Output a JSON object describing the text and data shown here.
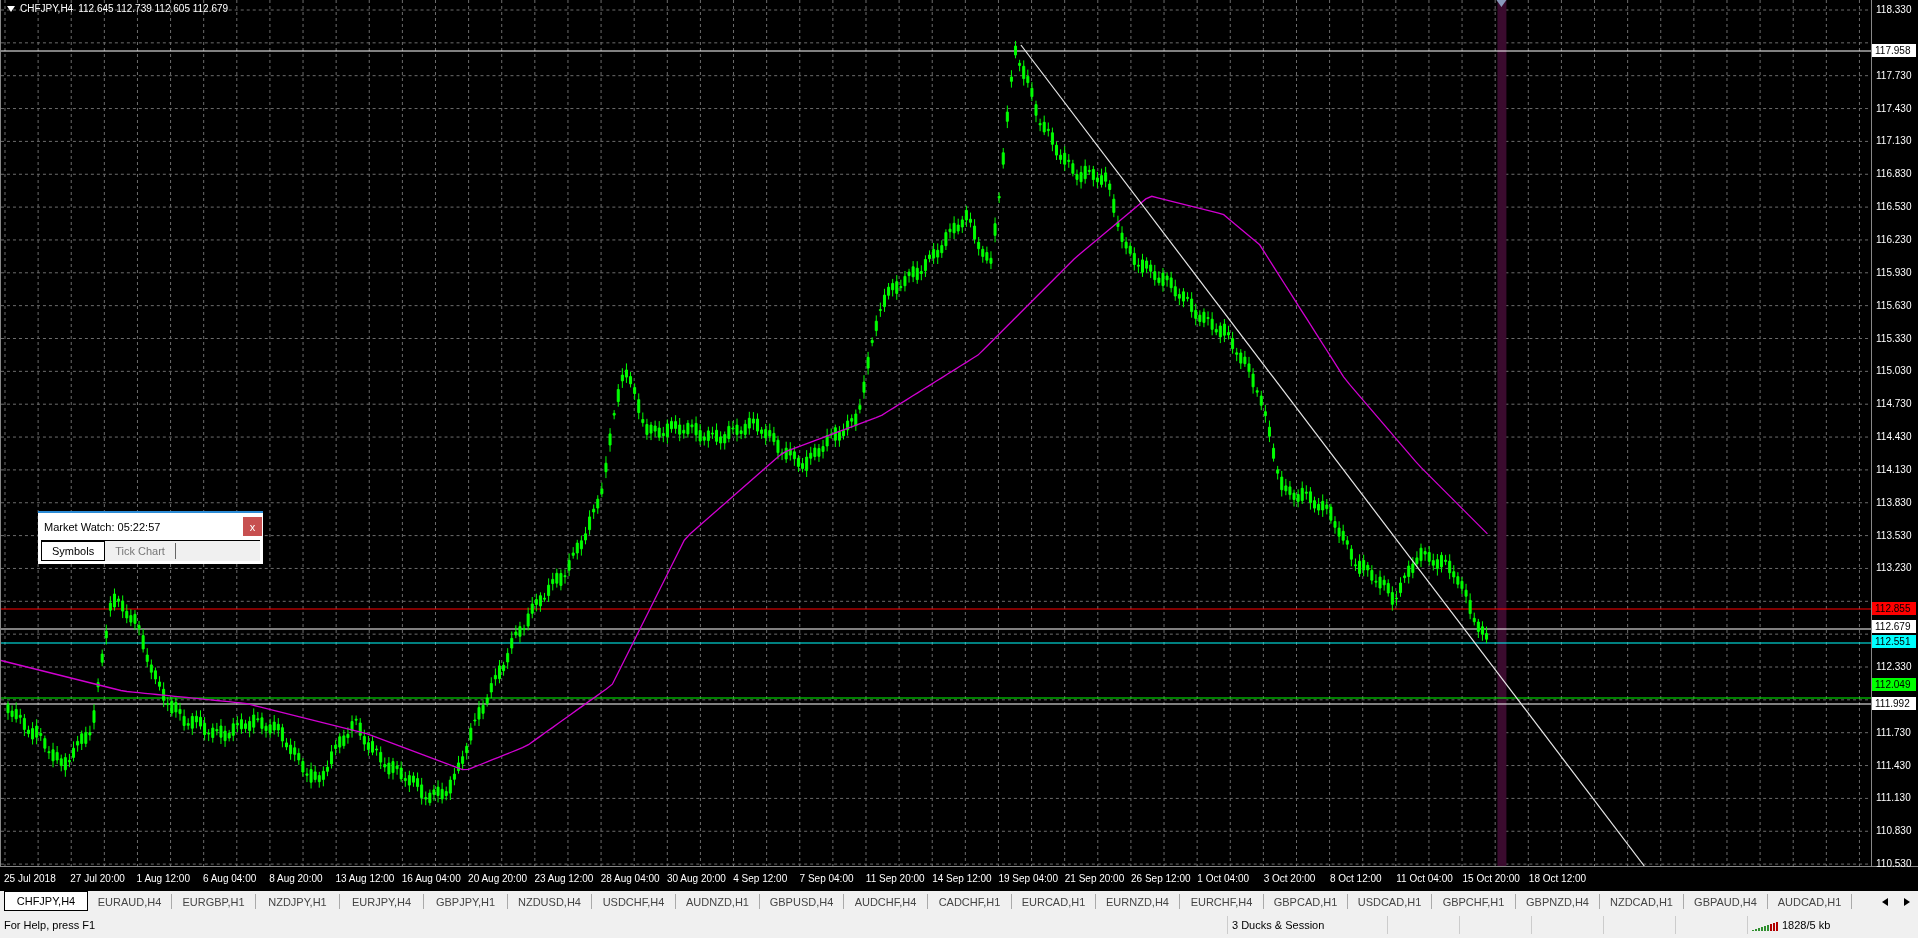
{
  "chart": {
    "header": {
      "symbol": "CHFJPY,H4",
      "quotes": "112.645 112.739 112.605 112.679"
    },
    "price_axis": {
      "ticks": [
        "118.330",
        "117.730",
        "117.430",
        "117.130",
        "116.830",
        "116.530",
        "116.230",
        "115.930",
        "115.630",
        "115.330",
        "115.030",
        "114.730",
        "114.430",
        "114.130",
        "113.830",
        "113.530",
        "113.230",
        "112.330",
        "111.730",
        "111.430",
        "111.130",
        "110.830",
        "110.530"
      ],
      "markers": [
        {
          "label": "117.958",
          "color": "#ffffff"
        },
        {
          "label": "112.855",
          "color": "#ff0000"
        },
        {
          "label": "112.679",
          "color": "#ffffff"
        },
        {
          "label": "112.551",
          "color": "#00ffff"
        },
        {
          "label": "112.049",
          "color": "#00ff00"
        },
        {
          "label": "111.992",
          "color": "#ffffff"
        }
      ]
    },
    "time_axis": {
      "labels": [
        "25 Jul 2018",
        "27 Jul 20:00",
        "1 Aug 12:00",
        "6 Aug 04:00",
        "8 Aug 20:00",
        "13 Aug 12:00",
        "16 Aug 04:00",
        "20 Aug 20:00",
        "23 Aug 12:00",
        "28 Aug 04:00",
        "30 Aug 20:00",
        "4 Sep 12:00",
        "7 Sep 04:00",
        "11 Sep 20:00",
        "14 Sep 12:00",
        "19 Sep 04:00",
        "21 Sep 20:00",
        "26 Sep 12:00",
        "1 Oct 04:00",
        "3 Oct 20:00",
        "8 Oct 12:00",
        "11 Oct 04:00",
        "15 Oct 20:00",
        "18 Oct 12:00"
      ]
    }
  },
  "market_watch": {
    "title": "Market Watch: 05:22:57",
    "close": "x",
    "tabs": [
      {
        "label": "Symbols",
        "selected": true
      },
      {
        "label": "Tick Chart",
        "selected": false
      }
    ]
  },
  "chart_tabs": [
    {
      "label": "CHFJPY,H4",
      "selected": true
    },
    {
      "label": "EURAUD,H4",
      "selected": false
    },
    {
      "label": "EURGBP,H1",
      "selected": false
    },
    {
      "label": "NZDJPY,H1",
      "selected": false
    },
    {
      "label": "EURJPY,H4",
      "selected": false
    },
    {
      "label": "GBPJPY,H1",
      "selected": false
    },
    {
      "label": "NZDUSD,H4",
      "selected": false
    },
    {
      "label": "USDCHF,H4",
      "selected": false
    },
    {
      "label": "AUDNZD,H1",
      "selected": false
    },
    {
      "label": "GBPUSD,H4",
      "selected": false
    },
    {
      "label": "AUDCHF,H4",
      "selected": false
    },
    {
      "label": "CADCHF,H1",
      "selected": false
    },
    {
      "label": "EURCAD,H1",
      "selected": false
    },
    {
      "label": "EURNZD,H4",
      "selected": false
    },
    {
      "label": "EURCHF,H4",
      "selected": false
    },
    {
      "label": "GBPCAD,H1",
      "selected": false
    },
    {
      "label": "USDCAD,H1",
      "selected": false
    },
    {
      "label": "GBPCHF,H1",
      "selected": false
    },
    {
      "label": "GBPNZD,H4",
      "selected": false
    },
    {
      "label": "NZDCAD,H1",
      "selected": false
    },
    {
      "label": "GBPAUD,H4",
      "selected": false
    },
    {
      "label": "AUDCAD,H1",
      "selected": false
    }
  ],
  "status_bar": {
    "help": "For Help, press F1",
    "profile": "3 Ducks & Session",
    "traffic": "1828/5 kb"
  }
}
